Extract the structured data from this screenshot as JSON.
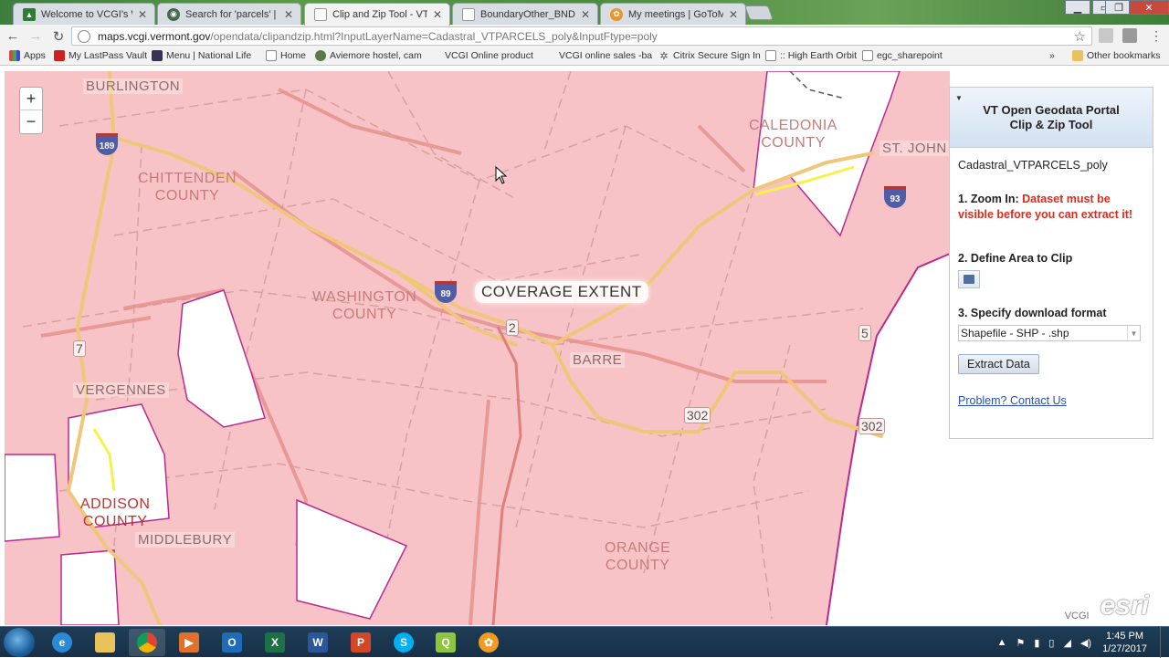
{
  "browser": {
    "tabs": [
      {
        "title": "Welcome to VCGI's Web",
        "color": "#2e7d32",
        "active": false
      },
      {
        "title": "Search for 'parcels' | Verm",
        "color": "#3f6b4e",
        "active": false
      },
      {
        "title": "Clip and Zip Tool - VT Op",
        "color": "#9aa3ad",
        "active": true
      },
      {
        "title": "BoundaryOther_BNDHA:",
        "color": "#9aa3ad",
        "active": false
      },
      {
        "title": "My meetings | GoToMee",
        "color": "#e8962f",
        "active": false
      }
    ],
    "url": {
      "host": "maps.vcgi.vermont.gov",
      "path": "/opendata/clipandzip.html?InputLayerName=Cadastral_VTPARCELS_poly&InputFtype=poly"
    },
    "bookmarks": [
      {
        "label": "Apps",
        "color": "#d44"
      },
      {
        "label": "My LastPass Vault",
        "color": "#c22"
      },
      {
        "label": "Menu | National Life",
        "color": "#335"
      },
      {
        "label": "Home",
        "color": "#888"
      },
      {
        "label": "Aviemore hostel, cam",
        "color": "#5a7a4a"
      },
      {
        "label": "VCGI Online product",
        "color": "#888"
      },
      {
        "label": "VCGI online sales -ba",
        "color": "#888"
      },
      {
        "label": "Citrix Secure Sign In",
        "color": "#555"
      },
      {
        "label": ":: High Earth Orbit",
        "color": "#888"
      },
      {
        "label": "egc_sharepoint",
        "color": "#888"
      }
    ],
    "bookmarks_more": "»",
    "other_bookmarks": "Other bookmarks"
  },
  "map": {
    "zoom_in": "+",
    "zoom_out": "−",
    "coverage_label": "COVERAGE EXTENT",
    "counties": [
      {
        "line1": "CALEDONIA",
        "line2": "COUNTY"
      },
      {
        "line1": "CHITTENDEN",
        "line2": "COUNTY"
      },
      {
        "line1": "WASHINGTON",
        "line2": "COUNTY"
      },
      {
        "line1": "ADDISON",
        "line2": "COUNTY"
      },
      {
        "line1": "ORANGE",
        "line2": "COUNTY"
      }
    ],
    "cities": [
      "BURLINGTON",
      "ST. JOHN",
      "VERGENNES",
      "BARRE",
      "MIDDLEBURY"
    ],
    "interstates": [
      "189",
      "89",
      "93"
    ],
    "routes": [
      "2",
      "7",
      "302",
      "5",
      "302"
    ],
    "attribution": "VCGI",
    "logo": "esri"
  },
  "panel": {
    "title_line1": "VT Open Geodata Portal",
    "title_line2": "Clip & Zip Tool",
    "layer_name": "Cadastral_VTPARCELS_poly",
    "step1": "1. Zoom In:",
    "step1_warning": "Dataset must be visible before you can extract it!",
    "step2": "2. Define Area to Clip",
    "step3": "3. Specify download format",
    "format_selected": "Shapefile - SHP - .shp",
    "extract_button": "Extract Data",
    "contact_link": "Problem? Contact Us"
  },
  "taskbar": {
    "time": "1:45 PM",
    "date": "1/27/2017"
  }
}
